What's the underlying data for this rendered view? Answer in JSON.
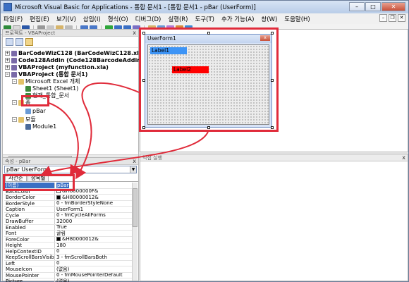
{
  "window": {
    "title": "Microsoft Visual Basic for Applications - 통합 문서1 - [통합 문서1 - pBar (UserForm)]"
  },
  "menu": [
    "파일(F)",
    "편집(E)",
    "보기(V)",
    "삽입(I)",
    "형식(O)",
    "디버그(D)",
    "실행(R)",
    "도구(T)",
    "추가 기능(A)",
    "창(W)",
    "도움말(H)"
  ],
  "project_panel": {
    "title": "프로젝트 - VBAProject",
    "close_label": "x",
    "tree": [
      {
        "label": "BarCodeWizC128 (BarCodeWizC128.xla)",
        "bold": true
      },
      {
        "label": "Code128Addin (Code128BarcodeAddinPrepende",
        "bold": true
      },
      {
        "label": "VBAProject (myfunction.xla)",
        "bold": true
      },
      {
        "label": "VBAProject (통합 문서1)",
        "bold": true
      },
      {
        "label": "Microsoft Excel 개체",
        "bold": false
      },
      {
        "label": "Sheet1 (Sheet1)",
        "bold": false
      },
      {
        "label": "현재_통합_문서",
        "bold": false
      },
      {
        "label": "폼",
        "bold": false
      },
      {
        "label": "pBar",
        "bold": false
      },
      {
        "label": "모듈",
        "bold": false
      },
      {
        "label": "Module1",
        "bold": false
      }
    ]
  },
  "properties_panel": {
    "title": "속성 - pBar",
    "close_label": "x",
    "object_selector": "pBar UserForm",
    "tabs": [
      "사전순",
      "항목별"
    ],
    "rows": [
      {
        "name": "(이름)",
        "value": "pBar",
        "color": null
      },
      {
        "name": "BackColor",
        "value": "&H8000000F&",
        "color": "#ffffff"
      },
      {
        "name": "BorderColor",
        "value": "&H80000012&",
        "color": "#000000"
      },
      {
        "name": "BorderStyle",
        "value": "0 - fmBorderStyleNone",
        "color": null
      },
      {
        "name": "Caption",
        "value": "UserForm1",
        "color": null
      },
      {
        "name": "Cycle",
        "value": "0 - fmCycleAllForms",
        "color": null
      },
      {
        "name": "DrawBuffer",
        "value": "32000",
        "color": null
      },
      {
        "name": "Enabled",
        "value": "True",
        "color": null
      },
      {
        "name": "Font",
        "value": "굴림",
        "color": null
      },
      {
        "name": "ForeColor",
        "value": "&H80000012&",
        "color": "#000000"
      },
      {
        "name": "Height",
        "value": "180",
        "color": null
      },
      {
        "name": "HelpContextID",
        "value": "0",
        "color": null
      },
      {
        "name": "KeepScrollBarsVisible",
        "value": "3 - fmScrollBarsBoth",
        "color": null
      },
      {
        "name": "Left",
        "value": "0",
        "color": null
      },
      {
        "name": "MouseIcon",
        "value": "(없음)",
        "color": null
      },
      {
        "name": "MousePointer",
        "value": "0 - fmMousePointerDefault",
        "color": null
      },
      {
        "name": "Picture",
        "value": "(없음)",
        "color": null
      }
    ]
  },
  "userform": {
    "title": "UserForm1",
    "close_label": "x",
    "label1": "Label1",
    "label2": "Label2"
  },
  "lower_pane": {
    "title": "직접 실행",
    "close_label": "x"
  },
  "colors": {
    "highlight": "#e02b3a",
    "label1_bg": "#3d94f6",
    "label2_bg": "#ff0000",
    "selection": "#3a6fc4"
  }
}
